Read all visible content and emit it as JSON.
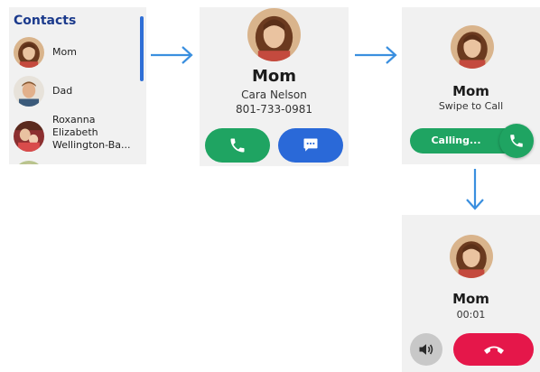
{
  "contacts_panel": {
    "title": "Contacts",
    "items": [
      {
        "name_lines": [
          "Mom"
        ],
        "avatar": "woman-long-hair-avatar"
      },
      {
        "name_lines": [
          "Dad"
        ],
        "avatar": "man-avatar"
      },
      {
        "name_lines": [
          "Roxanna",
          "Elizabeth",
          "Wellington-Ba..."
        ],
        "avatar": "woman-holding-child-avatar"
      }
    ]
  },
  "contact_detail": {
    "name": "Mom",
    "full_name": "Cara Nelson",
    "phone": "801-733-0981",
    "call_icon": "phone-icon",
    "message_icon": "chat-bubble-icon"
  },
  "swipe_screen": {
    "name": "Mom",
    "hint": "Swipe to Call",
    "slider_label": "Calling...",
    "knob_icon": "phone-icon"
  },
  "in_call_screen": {
    "name": "Mom",
    "timer": "00:01",
    "speaker_icon": "speaker-icon",
    "end_call_icon": "hang-up-icon"
  },
  "colors": {
    "green": "#1fa462",
    "blue": "#2a69d8",
    "red": "#e5174a",
    "arrow": "#3a8fdf",
    "panel_bg": "#f1f1f1",
    "title_blue": "#1b3a8c"
  }
}
